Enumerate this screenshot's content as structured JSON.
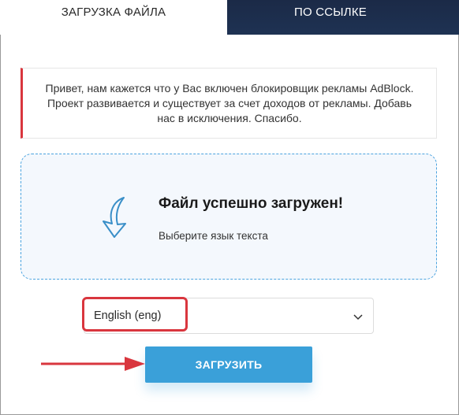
{
  "tabs": {
    "upload_label": "ЗАГРУЗКА ФАЙЛА",
    "link_label": "ПО ССЫЛКЕ"
  },
  "notice": {
    "line1": "Привет, нам кажется что у Вас включен блокировщик рекламы AdBlock.",
    "line2": "Проект развивается и существует за счет доходов от рекламы. Добавь",
    "line3": "нас в исключения. Спасибо."
  },
  "upload": {
    "title": "Файл успешно загружен!",
    "subtitle": "Выберите язык текста",
    "icon": "curved-arrow-down-icon"
  },
  "language_select": {
    "value": "English (eng)"
  },
  "submit": {
    "label": "ЗАГРУЗИТЬ"
  },
  "colors": {
    "accent": "#3aa0d9",
    "highlight": "#d9363e",
    "tab_dark": "#1e3253",
    "dropzone_bg": "#f4f8fd"
  }
}
